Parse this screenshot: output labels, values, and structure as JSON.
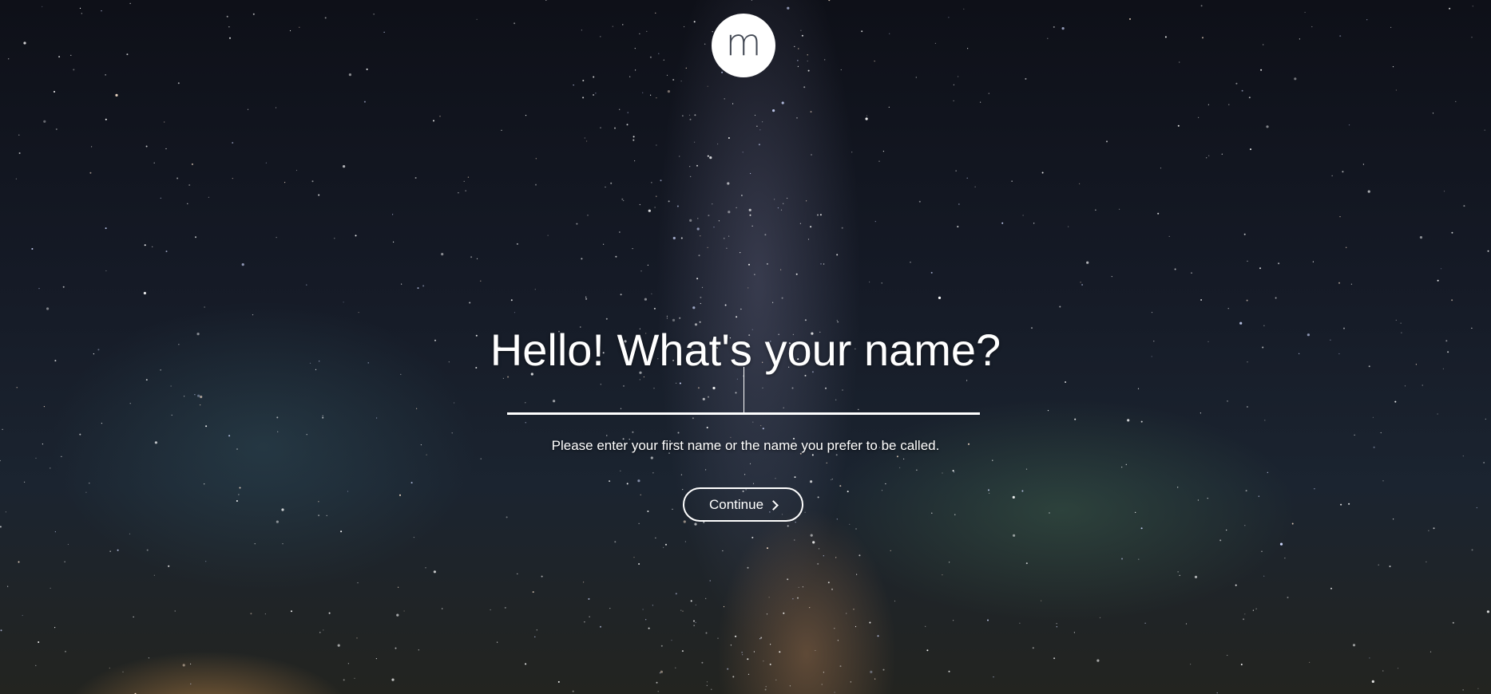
{
  "logo": {
    "letter": "m"
  },
  "prompt": {
    "title": "Hello! What's your name?",
    "hint": "Please enter your first name or the name you prefer to be called."
  },
  "name_input": {
    "value": "",
    "placeholder": ""
  },
  "continue_button": {
    "label": "Continue",
    "icon": "chevron-right-icon"
  },
  "background": {
    "description_icon": "starry-sky-background",
    "base_color": "#151a26"
  }
}
